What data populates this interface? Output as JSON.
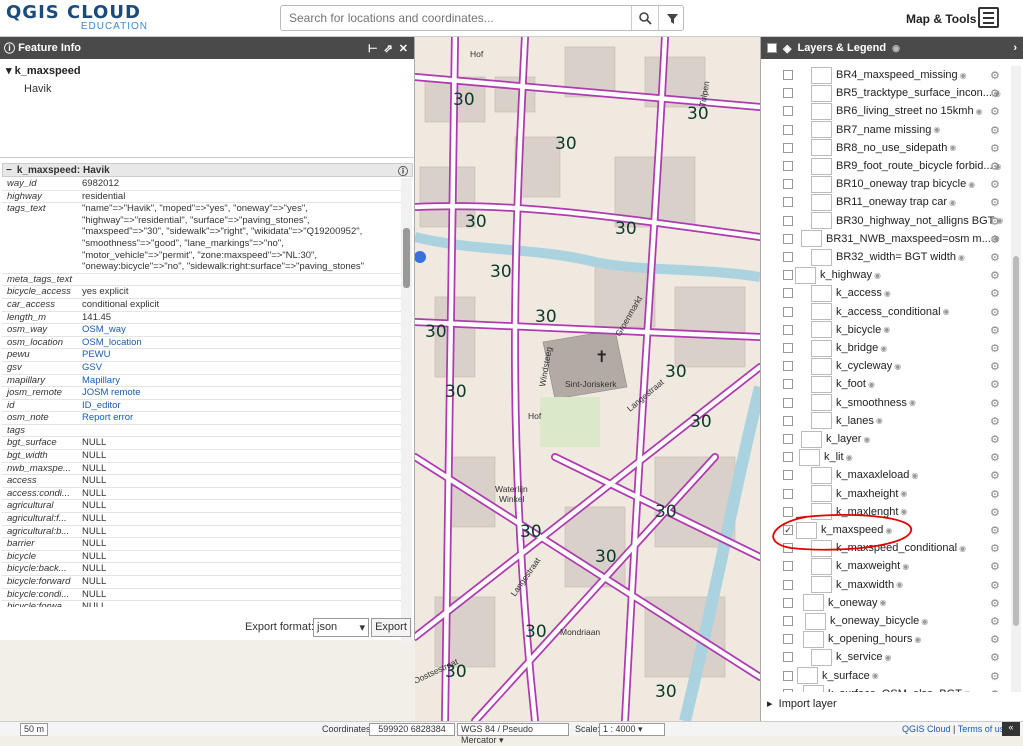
{
  "app": {
    "logo_main": "QGIS CLOUD",
    "logo_sub": "EDUCATION",
    "search_placeholder": "Search for locations and coordinates...",
    "map_tools_label": "Map & Tools"
  },
  "feature_info": {
    "title": "Feature Info",
    "tree_layer": "k_maxspeed",
    "tree_child": "Havik",
    "record_title": "k_maxspeed: Havik",
    "rows": [
      {
        "k": "way_id",
        "v": "6982012"
      },
      {
        "k": "highway",
        "v": "residential"
      },
      {
        "k": "tags_text",
        "v": "\"name\"=>\"Havik\", \"moped\"=>\"yes\", \"oneway\"=>\"yes\",\n\"highway\"=>\"residential\", \"surface\"=>\"paving_stones\",\n\"maxspeed\"=>\"30\", \"sidewalk\"=>\"right\", \"wikidata\"=>\"Q19200952\",\n\"smoothness\"=>\"good\", \"lane_markings\"=>\"no\",\n\"motor_vehicle\"=>\"permit\", \"zone:maxspeed\"=>\"NL:30\",\n\"oneway:bicycle\"=>\"no\", \"sidewalk:right:surface\"=>\"paving_stones\""
      },
      {
        "k": "meta_tags_text",
        "v": ""
      },
      {
        "k": "bicycle_access",
        "v": "yes explicit"
      },
      {
        "k": "car_access",
        "v": "conditional explicit"
      },
      {
        "k": "length_m",
        "v": "141.45"
      },
      {
        "k": "osm_way",
        "v": "OSM_way",
        "link": true
      },
      {
        "k": "osm_location",
        "v": "OSM_location",
        "link": true
      },
      {
        "k": "pewu",
        "v": "PEWU",
        "link": true
      },
      {
        "k": "gsv",
        "v": "GSV",
        "link": true
      },
      {
        "k": "mapillary",
        "v": "Mapillary",
        "link": true
      },
      {
        "k": "josm_remote",
        "v": "JOSM remote",
        "link": true
      },
      {
        "k": "id",
        "v": "ID_editor",
        "link": true
      },
      {
        "k": "osm_note",
        "v": "Report error",
        "link": true
      },
      {
        "k": "tags",
        "v": ""
      },
      {
        "k": "bgt_surface",
        "v": "NULL"
      },
      {
        "k": "bgt_width",
        "v": "NULL"
      },
      {
        "k": "nwb_maxspe...",
        "v": "NULL"
      },
      {
        "k": "access",
        "v": "NULL"
      },
      {
        "k": "access:condi...",
        "v": "NULL"
      },
      {
        "k": "agricultural",
        "v": "NULL"
      },
      {
        "k": "agricultural:f...",
        "v": "NULL"
      },
      {
        "k": "agricultural:b...",
        "v": "NULL"
      },
      {
        "k": "barrier",
        "v": "NULL"
      },
      {
        "k": "bicycle",
        "v": "NULL"
      },
      {
        "k": "bicycle:back...",
        "v": "NULL"
      },
      {
        "k": "bicycle:forward",
        "v": "NULL"
      },
      {
        "k": "bicycle:condi...",
        "v": "NULL"
      },
      {
        "k": "bicycle:forwa...",
        "v": "NULL"
      }
    ],
    "export_label": "Export format:",
    "export_format": "json",
    "export_button": "Export"
  },
  "layers_panel": {
    "title": "Layers & Legend",
    "layers": [
      {
        "name": "BR4_maxspeed_missing",
        "indent": 0,
        "checked": false
      },
      {
        "name": "BR5_tracktype_surface_incon...",
        "indent": 0,
        "checked": false
      },
      {
        "name": "BR6_living_street no 15kmh",
        "indent": 0,
        "checked": false
      },
      {
        "name": "BR7_name missing",
        "indent": 0,
        "checked": false
      },
      {
        "name": "BR8_no_use_sidepath",
        "indent": 0,
        "checked": false
      },
      {
        "name": "BR9_foot_route_bicycle forbid...",
        "indent": 0,
        "checked": false
      },
      {
        "name": "BR10_oneway trap bicycle",
        "indent": 0,
        "checked": false
      },
      {
        "name": "BR11_oneway trap car",
        "indent": 0,
        "checked": false
      },
      {
        "name": "BR30_highway_not_alligns BGT",
        "indent": 0,
        "checked": false
      },
      {
        "name": "BR31_NWB_maxspeed=osm m...",
        "indent": -10,
        "checked": false
      },
      {
        "name": "BR32_width= BGT width",
        "indent": 0,
        "checked": false
      },
      {
        "name": "k_highway",
        "indent": -16,
        "checked": false
      },
      {
        "name": "k_access",
        "indent": 0,
        "checked": false
      },
      {
        "name": "k_access_conditional",
        "indent": 0,
        "checked": false
      },
      {
        "name": "k_bicycle",
        "indent": 0,
        "checked": false
      },
      {
        "name": "k_bridge",
        "indent": 0,
        "checked": false
      },
      {
        "name": "k_cycleway",
        "indent": 0,
        "checked": false
      },
      {
        "name": "k_foot",
        "indent": 0,
        "checked": false
      },
      {
        "name": "k_smoothness",
        "indent": 0,
        "checked": false
      },
      {
        "name": "k_lanes",
        "indent": 0,
        "checked": false
      },
      {
        "name": "k_layer",
        "indent": -10,
        "checked": false
      },
      {
        "name": "k_lit",
        "indent": -12,
        "checked": false
      },
      {
        "name": "k_maxaxleload",
        "indent": 0,
        "checked": false
      },
      {
        "name": "k_maxheight",
        "indent": 0,
        "checked": false
      },
      {
        "name": "k_maxlenght",
        "indent": 0,
        "checked": false
      },
      {
        "name": "k_maxspeed",
        "indent": -15,
        "checked": true
      },
      {
        "name": "k_maxspeed_conditional",
        "indent": 0,
        "checked": false
      },
      {
        "name": "k_maxweight",
        "indent": 0,
        "checked": false
      },
      {
        "name": "k_maxwidth",
        "indent": 0,
        "checked": false
      },
      {
        "name": "k_oneway",
        "indent": -8,
        "checked": false
      },
      {
        "name": "k_oneway_bicycle",
        "indent": -6,
        "checked": false
      },
      {
        "name": "k_opening_hours",
        "indent": -8,
        "checked": false
      },
      {
        "name": "k_service",
        "indent": 0,
        "checked": false
      },
      {
        "name": "k_surface",
        "indent": -14,
        "checked": false
      },
      {
        "name": "k_surface_OSM_else_BGT",
        "indent": -8,
        "checked": false
      }
    ],
    "import_label": "Import layer"
  },
  "map": {
    "speed_label": "30",
    "labels": [
      "Hof",
      "Sint-Joriskerk",
      "Groenmarkt",
      "Langestraat",
      "Windsteeg",
      "Hof",
      "Waterlijn",
      "Winkel",
      "Mondriaan",
      "Langestraat",
      "Oostsestraat",
      "Tulpen"
    ]
  },
  "status": {
    "scale_bar": "50 m",
    "coord_label": "Coordinates:",
    "coord_value": "599920 6828384",
    "crs": "WGS 84 / Pseudo Mercator",
    "scale_label": "Scale:",
    "scale_value": "1 : 4000",
    "qgis_cloud": "QGIS Cloud",
    "sep": " | ",
    "terms": "Terms of use"
  },
  "colors": {
    "road_outline": "#b03ab0",
    "road_fill": "#ffffff",
    "annotation_red": "#e00000",
    "header_dark": "#4a4a4a"
  }
}
